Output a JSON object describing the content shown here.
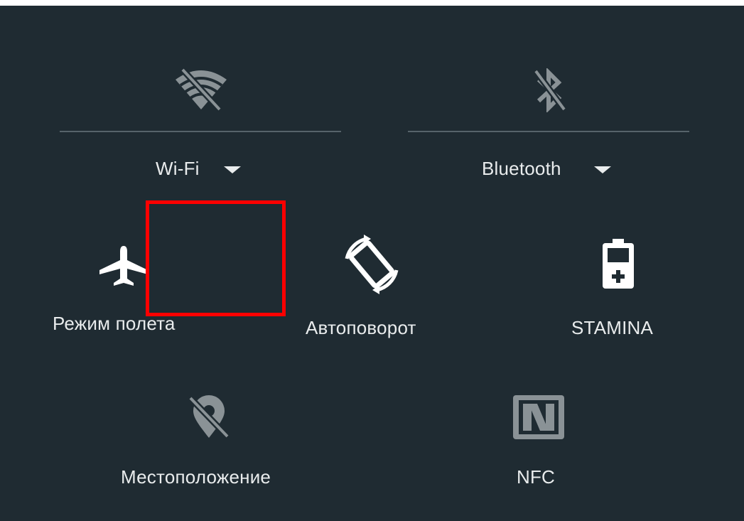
{
  "quick_settings": {
    "wifi": {
      "label": "Wi-Fi",
      "icon": "wifi-off-icon",
      "state": "off"
    },
    "bluetooth": {
      "label": "Bluetooth",
      "icon": "bluetooth-off-icon",
      "state": "off"
    },
    "airplane": {
      "label": "Режим полета",
      "icon": "airplane-icon"
    },
    "autorotate": {
      "label": "Автоповорот",
      "icon": "screen-rotation-icon"
    },
    "stamina": {
      "label": "STAMINA",
      "icon": "battery-stamina-icon"
    },
    "location": {
      "label": "Местоположение",
      "icon": "location-off-icon",
      "state": "off"
    },
    "nfc": {
      "label": "NFC",
      "icon": "nfc-icon",
      "state": "off"
    }
  },
  "colors": {
    "panel_bg": "#1f2b32",
    "active_icon": "#ffffff",
    "inactive_icon": "#8a9296",
    "label_text": "#e9eced",
    "highlight": "#ff0000"
  }
}
